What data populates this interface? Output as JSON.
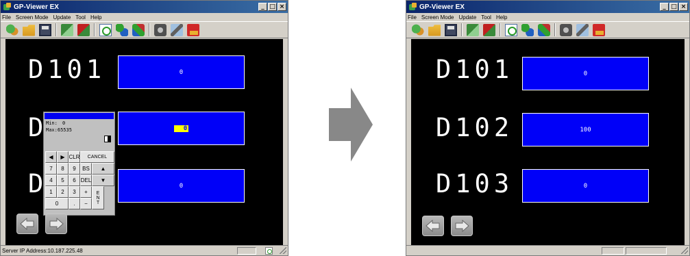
{
  "left": {
    "title": "GP-Viewer EX",
    "menu": [
      "File",
      "Screen Mode",
      "Update",
      "Tool",
      "Help"
    ],
    "rows": [
      {
        "address": "D101",
        "value": "0"
      },
      {
        "address": "D102",
        "value": "0"
      },
      {
        "address": "D103",
        "value": "0"
      }
    ],
    "keypad": {
      "min_label": "Min:",
      "min_value": "0",
      "max_label": "Max:",
      "max_value": "65535",
      "keys": [
        "◀",
        "▶",
        "CLR",
        "CANCEL",
        "7",
        "8",
        "9",
        "BS",
        "▲",
        "4",
        "5",
        "6",
        "DEL",
        "▼",
        "1",
        "2",
        "3",
        "+",
        "E N T",
        "0",
        ".",
        "−"
      ]
    },
    "status": "Server IP Address:10.187.225.48"
  },
  "right": {
    "title": "GP-Viewer EX",
    "menu": [
      "File",
      "Screen Mode",
      "Update",
      "Tool",
      "Help"
    ],
    "rows": [
      {
        "address": "D101",
        "value": "0"
      },
      {
        "address": "D102",
        "value": "100"
      },
      {
        "address": "D103",
        "value": "0"
      }
    ],
    "status": ""
  },
  "window_buttons": [
    "_",
    "□",
    "×"
  ],
  "toolbar_icons": [
    "connect-icon",
    "open-folder-icon",
    "save-icon",
    "screen-green-icon",
    "screen-red-icon",
    "refresh-icon",
    "transfer-icon",
    "multi-icon",
    "camera-icon",
    "tool-icon",
    "id-icon"
  ],
  "colors": {
    "field_blue": "#0000f8",
    "input_cursor": "#ffff00",
    "canvas": "#000000",
    "titlebar": "#0a246a"
  }
}
